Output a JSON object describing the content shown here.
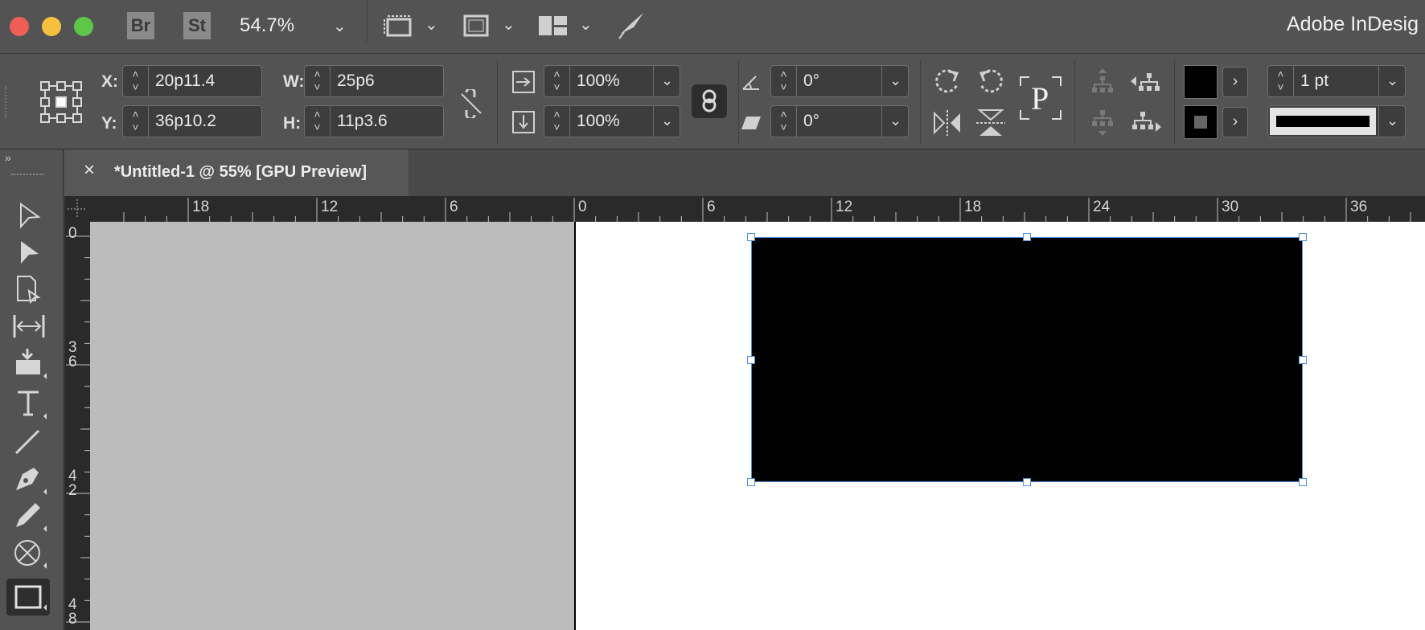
{
  "app": {
    "title": "Adobe InDesig",
    "bridge_label": "Br",
    "stock_label": "St",
    "zoom": "54.7%"
  },
  "control": {
    "x_label": "X:",
    "x_value": "20p11.4",
    "y_label": "Y:",
    "y_value": "36p10.2",
    "w_label": "W:",
    "w_value": "25p6",
    "h_label": "H:",
    "h_value": "11p3.6",
    "scale_x": "100%",
    "scale_y": "100%",
    "rotation": "0°",
    "shear": "0°",
    "stroke_weight": "1 pt",
    "p_label": "P"
  },
  "document": {
    "tab_title": "*Untitled-1 @ 55% [GPU Preview]",
    "close_glyph": "×"
  },
  "ruler": {
    "h_labels": [
      "18",
      "12",
      "6",
      "0",
      "6",
      "12",
      "18",
      "24",
      "30",
      "36"
    ],
    "v_labels": [
      "0",
      "3\n6",
      "4\n2",
      "4\n8"
    ]
  },
  "colors": {
    "traffic_red": "#ee5e56",
    "traffic_yellow": "#f6bf3e",
    "traffic_green": "#5ec648",
    "selection": "#4a90e2",
    "frame_fill": "#000000"
  }
}
